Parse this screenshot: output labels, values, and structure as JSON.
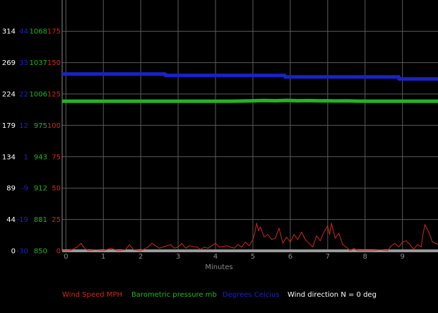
{
  "chart_data": {
    "type": "line",
    "xlabel": "Minutes",
    "x_ticks": [
      "0",
      "1",
      "2",
      "3",
      "4",
      "5",
      "6",
      "7",
      "8",
      "9"
    ],
    "xlim": [
      -0.1,
      9.95
    ],
    "grid": true,
    "y_axes": [
      {
        "name": "wind_direction",
        "color": "#ffffff",
        "ticks": [
          "0",
          "44",
          "89",
          "134",
          "179",
          "224",
          "269",
          "314"
        ]
      },
      {
        "name": "degrees_celsius",
        "color": "#1a22c8",
        "ticks": [
          "-30",
          "-19",
          "-9",
          "1",
          "12",
          "22",
          "33",
          "44"
        ]
      },
      {
        "name": "pressure",
        "color": "#21b521",
        "ticks": [
          "850",
          "881",
          "912",
          "943",
          "975",
          "1006",
          "1037",
          "1068"
        ]
      },
      {
        "name": "wind_speed",
        "color": "#cc2a1a",
        "ticks": [
          "0",
          "25",
          "50",
          "75",
          "100",
          "125",
          "150",
          "175"
        ]
      }
    ],
    "legend": {
      "placement": "bottom",
      "items": [
        {
          "label": "Wind Speed MPH",
          "color": "#cc2a1a"
        },
        {
          "label": "Barometric pressure mb",
          "color": "#21b521"
        },
        {
          "label": "Degrees Celcius",
          "color": "#1a22c8"
        },
        {
          "label": "Wind direction N = 0 deg",
          "color": "#ffffff"
        }
      ]
    },
    "series": [
      {
        "name": "Degrees Celcius",
        "color": "#1a22c8",
        "axis": "degrees_celsius",
        "step": true,
        "x": [
          -0.1,
          2.65,
          2.66,
          5.85,
          5.86,
          8.9,
          8.91,
          9.95
        ],
        "y": [
          29.6,
          29.6,
          29.1,
          29.1,
          28.6,
          28.6,
          27.9,
          27.9
        ]
      },
      {
        "name": "Barometric pressure mb",
        "color": "#21b521",
        "axis": "pressure",
        "x": [
          -0.1,
          4.4,
          4.7,
          5.0,
          5.3,
          5.6,
          5.9,
          6.2,
          6.5,
          6.8,
          7.0,
          7.2,
          7.5,
          7.8,
          8.1,
          9.95
        ],
        "y": [
          998.5,
          998.5,
          998.7,
          999.0,
          999.2,
          999.0,
          999.3,
          999.0,
          999.1,
          998.9,
          999.0,
          998.8,
          998.9,
          998.6,
          998.5,
          998.5
        ]
      },
      {
        "name": "Wind direction N = 0 deg",
        "color": "#9a9a9a",
        "axis": "wind_direction",
        "x": [
          -0.1,
          9.95
        ],
        "y": [
          0,
          0
        ]
      },
      {
        "name": "Wind Speed MPH",
        "color": "#cc2a1a",
        "axis": "wind_speed",
        "x": [
          -0.1,
          0.1,
          0.3,
          0.4,
          0.5,
          0.6,
          0.8,
          1.0,
          1.2,
          1.4,
          1.6,
          1.7,
          1.8,
          2.0,
          2.2,
          2.3,
          2.5,
          2.7,
          2.8,
          2.9,
          3.0,
          3.1,
          3.2,
          3.3,
          3.5,
          3.6,
          3.7,
          3.8,
          4.0,
          4.1,
          4.3,
          4.5,
          4.6,
          4.7,
          4.8,
          4.9,
          5.0,
          5.05,
          5.1,
          5.15,
          5.2,
          5.3,
          5.4,
          5.5,
          5.6,
          5.7,
          5.8,
          5.9,
          6.0,
          6.1,
          6.2,
          6.3,
          6.4,
          6.5,
          6.6,
          6.7,
          6.8,
          6.9,
          7.0,
          7.05,
          7.1,
          7.2,
          7.3,
          7.4,
          7.5,
          7.6,
          7.7,
          7.8,
          8.0,
          8.2,
          8.4,
          8.6,
          8.7,
          8.8,
          8.9,
          9.0,
          9.1,
          9.2,
          9.3,
          9.4,
          9.5,
          9.55,
          9.6,
          9.7,
          9.8,
          9.95
        ],
        "y": [
          0,
          0,
          3,
          6,
          2,
          0,
          1,
          0,
          2,
          0,
          1,
          5,
          1,
          0,
          3,
          6,
          2,
          4,
          5,
          2,
          3,
          6,
          2,
          4,
          3,
          1,
          3,
          2,
          6,
          3,
          4,
          2,
          5,
          3,
          7,
          4,
          9,
          14,
          22,
          16,
          19,
          11,
          13,
          9,
          10,
          18,
          6,
          11,
          7,
          13,
          9,
          15,
          9,
          6,
          3,
          12,
          8,
          15,
          20,
          13,
          22,
          10,
          14,
          5,
          3,
          0,
          2,
          0,
          0,
          0,
          1,
          0,
          4,
          6,
          3,
          7,
          8,
          5,
          1,
          5,
          3,
          13,
          21,
          15,
          7,
          5
        ]
      }
    ]
  }
}
